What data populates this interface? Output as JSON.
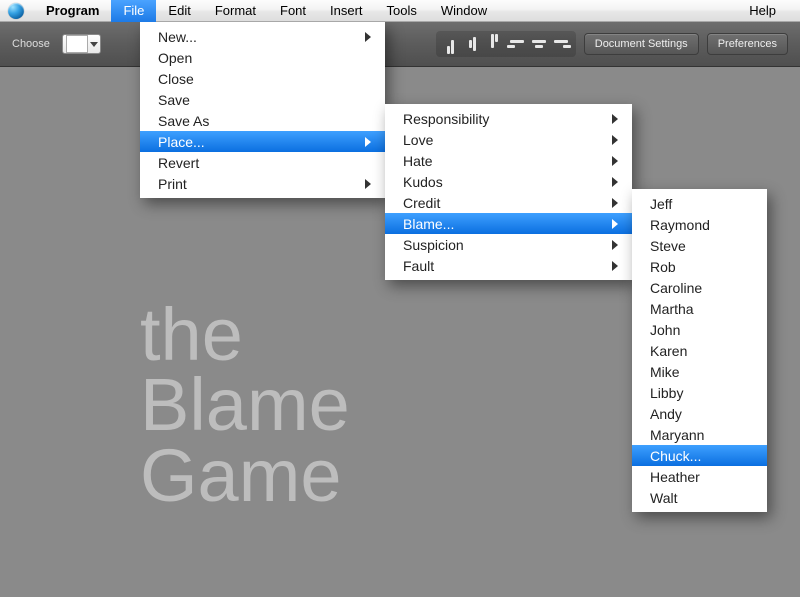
{
  "menubar": {
    "program": "Program",
    "file": "File",
    "edit": "Edit",
    "format": "Format",
    "font": "Font",
    "insert": "Insert",
    "tools": "Tools",
    "window": "Window",
    "help": "Help"
  },
  "toolbar": {
    "choose_label": "Choose",
    "doc_settings": "Document Settings",
    "preferences": "Preferences"
  },
  "file_menu": {
    "new": "New...",
    "open": "Open",
    "close": "Close",
    "save": "Save",
    "save_as": "Save As",
    "place": "Place...",
    "revert": "Revert",
    "print": "Print"
  },
  "place_menu": {
    "responsibility": "Responsibility",
    "love": "Love",
    "hate": "Hate",
    "kudos": "Kudos",
    "credit": "Credit",
    "blame": "Blame...",
    "suspicion": "Suspicion",
    "fault": "Fault"
  },
  "blame_menu": {
    "jeff": "Jeff",
    "raymond": "Raymond",
    "steve": "Steve",
    "rob": "Rob",
    "caroline": "Caroline",
    "martha": "Martha",
    "john": "John",
    "karen": "Karen",
    "mike": "Mike",
    "libby": "Libby",
    "andy": "Andy",
    "maryann": "Maryann",
    "chuck": "Chuck...",
    "heather": "Heather",
    "walt": "Walt"
  },
  "title": {
    "line1": "the",
    "line2": "Blame",
    "line3": "Game"
  }
}
